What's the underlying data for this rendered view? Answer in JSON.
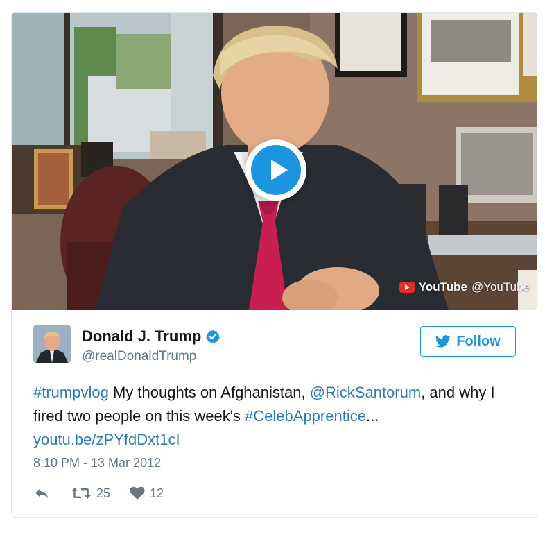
{
  "media": {
    "provider": "YouTube",
    "provider_handle": "@YouTube",
    "play_icon": "play-icon",
    "logo_icon": "youtube-logo-icon"
  },
  "author": {
    "display_name": "Donald J. Trump",
    "screen_name": "@realDonaldTrump",
    "verified_icon": "verified-badge-icon",
    "avatar": "avatar"
  },
  "follow": {
    "label": "Follow",
    "icon": "twitter-bird-icon"
  },
  "tweet": {
    "hashtag1": "#trumpvlog",
    "text1": " My thoughts on Afghanistan, ",
    "mention": "@RickSantorum",
    "text2": ", and why I fired two people on this week's ",
    "hashtag2": "#CelebApprentice",
    "text3": "...",
    "link": "youtu.be/zPYfdDxt1cI"
  },
  "timestamp": "8:10 PM - 13 Mar 2012",
  "actions": {
    "reply_icon": "reply-icon",
    "retweet_icon": "retweet-icon",
    "retweet_count": "25",
    "like_icon": "heart-icon",
    "like_count": "12"
  },
  "colors": {
    "accent": "#1b95e0",
    "link": "#2b7bb9",
    "secondary_text": "#657786",
    "youtube_red": "#e52d27"
  }
}
